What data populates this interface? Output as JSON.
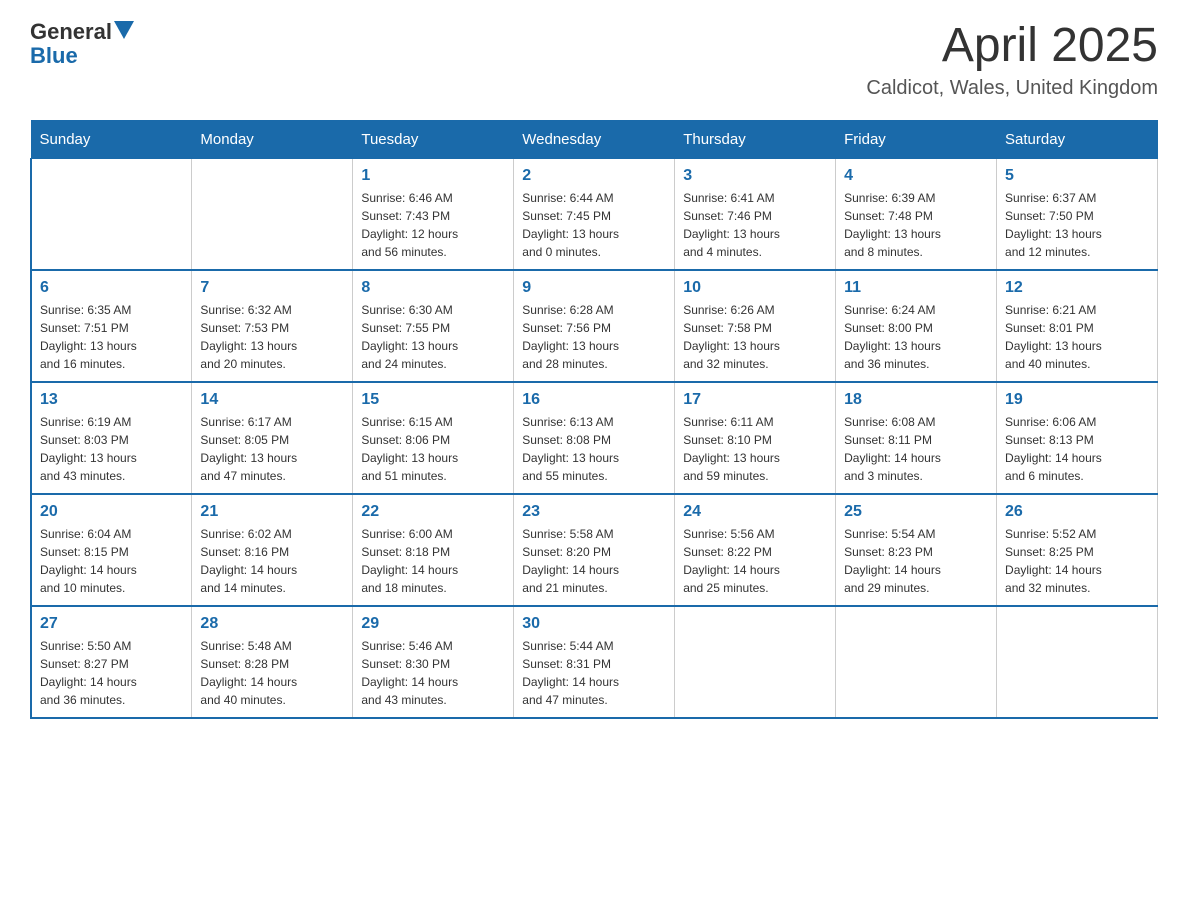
{
  "header": {
    "logo_general": "General",
    "logo_blue": "Blue",
    "month_title": "April 2025",
    "location": "Caldicot, Wales, United Kingdom"
  },
  "columns": [
    "Sunday",
    "Monday",
    "Tuesday",
    "Wednesday",
    "Thursday",
    "Friday",
    "Saturday"
  ],
  "weeks": [
    [
      {
        "day": "",
        "info": ""
      },
      {
        "day": "",
        "info": ""
      },
      {
        "day": "1",
        "info": "Sunrise: 6:46 AM\nSunset: 7:43 PM\nDaylight: 12 hours\nand 56 minutes."
      },
      {
        "day": "2",
        "info": "Sunrise: 6:44 AM\nSunset: 7:45 PM\nDaylight: 13 hours\nand 0 minutes."
      },
      {
        "day": "3",
        "info": "Sunrise: 6:41 AM\nSunset: 7:46 PM\nDaylight: 13 hours\nand 4 minutes."
      },
      {
        "day": "4",
        "info": "Sunrise: 6:39 AM\nSunset: 7:48 PM\nDaylight: 13 hours\nand 8 minutes."
      },
      {
        "day": "5",
        "info": "Sunrise: 6:37 AM\nSunset: 7:50 PM\nDaylight: 13 hours\nand 12 minutes."
      }
    ],
    [
      {
        "day": "6",
        "info": "Sunrise: 6:35 AM\nSunset: 7:51 PM\nDaylight: 13 hours\nand 16 minutes."
      },
      {
        "day": "7",
        "info": "Sunrise: 6:32 AM\nSunset: 7:53 PM\nDaylight: 13 hours\nand 20 minutes."
      },
      {
        "day": "8",
        "info": "Sunrise: 6:30 AM\nSunset: 7:55 PM\nDaylight: 13 hours\nand 24 minutes."
      },
      {
        "day": "9",
        "info": "Sunrise: 6:28 AM\nSunset: 7:56 PM\nDaylight: 13 hours\nand 28 minutes."
      },
      {
        "day": "10",
        "info": "Sunrise: 6:26 AM\nSunset: 7:58 PM\nDaylight: 13 hours\nand 32 minutes."
      },
      {
        "day": "11",
        "info": "Sunrise: 6:24 AM\nSunset: 8:00 PM\nDaylight: 13 hours\nand 36 minutes."
      },
      {
        "day": "12",
        "info": "Sunrise: 6:21 AM\nSunset: 8:01 PM\nDaylight: 13 hours\nand 40 minutes."
      }
    ],
    [
      {
        "day": "13",
        "info": "Sunrise: 6:19 AM\nSunset: 8:03 PM\nDaylight: 13 hours\nand 43 minutes."
      },
      {
        "day": "14",
        "info": "Sunrise: 6:17 AM\nSunset: 8:05 PM\nDaylight: 13 hours\nand 47 minutes."
      },
      {
        "day": "15",
        "info": "Sunrise: 6:15 AM\nSunset: 8:06 PM\nDaylight: 13 hours\nand 51 minutes."
      },
      {
        "day": "16",
        "info": "Sunrise: 6:13 AM\nSunset: 8:08 PM\nDaylight: 13 hours\nand 55 minutes."
      },
      {
        "day": "17",
        "info": "Sunrise: 6:11 AM\nSunset: 8:10 PM\nDaylight: 13 hours\nand 59 minutes."
      },
      {
        "day": "18",
        "info": "Sunrise: 6:08 AM\nSunset: 8:11 PM\nDaylight: 14 hours\nand 3 minutes."
      },
      {
        "day": "19",
        "info": "Sunrise: 6:06 AM\nSunset: 8:13 PM\nDaylight: 14 hours\nand 6 minutes."
      }
    ],
    [
      {
        "day": "20",
        "info": "Sunrise: 6:04 AM\nSunset: 8:15 PM\nDaylight: 14 hours\nand 10 minutes."
      },
      {
        "day": "21",
        "info": "Sunrise: 6:02 AM\nSunset: 8:16 PM\nDaylight: 14 hours\nand 14 minutes."
      },
      {
        "day": "22",
        "info": "Sunrise: 6:00 AM\nSunset: 8:18 PM\nDaylight: 14 hours\nand 18 minutes."
      },
      {
        "day": "23",
        "info": "Sunrise: 5:58 AM\nSunset: 8:20 PM\nDaylight: 14 hours\nand 21 minutes."
      },
      {
        "day": "24",
        "info": "Sunrise: 5:56 AM\nSunset: 8:22 PM\nDaylight: 14 hours\nand 25 minutes."
      },
      {
        "day": "25",
        "info": "Sunrise: 5:54 AM\nSunset: 8:23 PM\nDaylight: 14 hours\nand 29 minutes."
      },
      {
        "day": "26",
        "info": "Sunrise: 5:52 AM\nSunset: 8:25 PM\nDaylight: 14 hours\nand 32 minutes."
      }
    ],
    [
      {
        "day": "27",
        "info": "Sunrise: 5:50 AM\nSunset: 8:27 PM\nDaylight: 14 hours\nand 36 minutes."
      },
      {
        "day": "28",
        "info": "Sunrise: 5:48 AM\nSunset: 8:28 PM\nDaylight: 14 hours\nand 40 minutes."
      },
      {
        "day": "29",
        "info": "Sunrise: 5:46 AM\nSunset: 8:30 PM\nDaylight: 14 hours\nand 43 minutes."
      },
      {
        "day": "30",
        "info": "Sunrise: 5:44 AM\nSunset: 8:31 PM\nDaylight: 14 hours\nand 47 minutes."
      },
      {
        "day": "",
        "info": ""
      },
      {
        "day": "",
        "info": ""
      },
      {
        "day": "",
        "info": ""
      }
    ]
  ]
}
